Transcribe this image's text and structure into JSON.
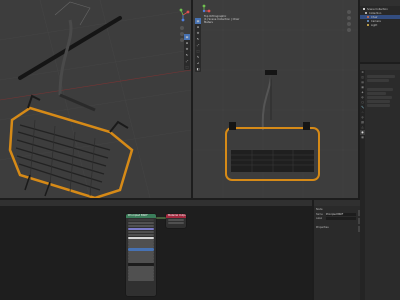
{
  "viewport_left": {
    "header": "",
    "tools": [
      "select-icon",
      "cursor-icon",
      "move-icon",
      "rotate-icon",
      "scale-icon",
      "transform-icon",
      "annotate-icon",
      "measure-icon",
      "add-cube-icon"
    ]
  },
  "viewport_right": {
    "header": "",
    "overlay": [
      "Top Orthographic",
      "(1) Scene Collection | Chair",
      "Meters"
    ],
    "tools": [
      "select-icon",
      "cursor-icon",
      "move-icon",
      "rotate-icon",
      "scale-icon",
      "transform-icon",
      "annotate-icon",
      "measure-icon",
      "add-cube-icon"
    ]
  },
  "outliner": {
    "header": "Scene Collection",
    "rows": [
      {
        "label": "Scene Collection",
        "color": "#ffffff",
        "selected": false
      },
      {
        "label": "Collection",
        "color": "#d8d8d8",
        "selected": false
      },
      {
        "label": "Chair",
        "color": "#e07040",
        "selected": true
      },
      {
        "label": "Camera",
        "color": "#6fa0d8",
        "selected": false
      },
      {
        "label": "Light",
        "color": "#e8c050",
        "selected": false
      }
    ]
  },
  "properties": {
    "header": "Properties",
    "tabs": [
      "tool-icon",
      "render-icon",
      "output-icon",
      "view-layer-icon",
      "scene-icon",
      "world-icon",
      "object-icon",
      "modifier-icon",
      "particles-icon",
      "physics-icon",
      "constraints-icon",
      "data-icon",
      "material-icon",
      "texture-icon"
    ],
    "active_tab": 12
  },
  "node_editor": {
    "header": "Shader Editor",
    "bsdf_title": "Principled BSDF",
    "output_title": "Material Output",
    "bsdf_color": "#3b7d5a",
    "output_color": "#a3283e"
  },
  "node_props": {
    "header": "Node",
    "name_label": "Name",
    "name_value": "Principled BSDF",
    "label_label": "Label",
    "props_label": "Properties"
  },
  "colors": {
    "accent": "#4772b3",
    "chair_orange": "#d68a17",
    "viewport_bg": "#3d3d3d"
  }
}
